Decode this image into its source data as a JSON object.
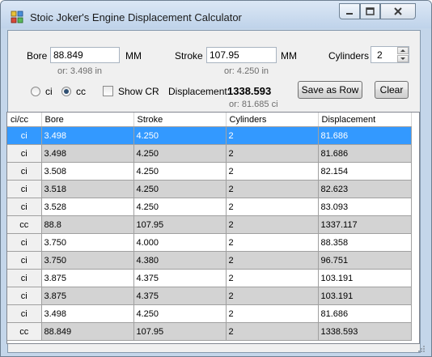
{
  "window": {
    "title": "Stoic Joker's Engine Displacement Calculator"
  },
  "inputs": {
    "bore_label": "Bore",
    "bore_value": "88.849",
    "bore_unit": "MM",
    "bore_in": "or: 3.498 in",
    "stroke_label": "Stroke",
    "stroke_value": "107.95",
    "stroke_unit": "MM",
    "stroke_in": "or: 4.250 in",
    "cylinders_label": "Cylinders",
    "cylinders_value": "2"
  },
  "mode": {
    "ci_label": "ci",
    "cc_label": "cc",
    "selected": "cc",
    "show_cr_label": "Show CR",
    "show_cr_checked": false
  },
  "result": {
    "label": "Displacement:",
    "value": "1338.593",
    "ci": "or: 81.685 ci"
  },
  "buttons": {
    "save": "Save as Row",
    "clear": "Clear"
  },
  "table": {
    "columns": [
      "ci/cc",
      "Bore",
      "Stroke",
      "Cylinders",
      "Displacement"
    ],
    "rows": [
      [
        "ci",
        "3.498",
        "4.250",
        "2",
        "81.686"
      ],
      [
        "ci",
        "3.498",
        "4.250",
        "2",
        "81.686"
      ],
      [
        "ci",
        "3.508",
        "4.250",
        "2",
        "82.154"
      ],
      [
        "ci",
        "3.518",
        "4.250",
        "2",
        "82.623"
      ],
      [
        "ci",
        "3.528",
        "4.250",
        "2",
        "83.093"
      ],
      [
        "cc",
        "88.8",
        "107.95",
        "2",
        "1337.117"
      ],
      [
        "ci",
        "3.750",
        "4.000",
        "2",
        "88.358"
      ],
      [
        "ci",
        "3.750",
        "4.380",
        "2",
        "96.751"
      ],
      [
        "ci",
        "3.875",
        "4.375",
        "2",
        "103.191"
      ],
      [
        "ci",
        "3.875",
        "4.375",
        "2",
        "103.191"
      ],
      [
        "ci",
        "3.498",
        "4.250",
        "2",
        "81.686"
      ],
      [
        "cc",
        "88.849",
        "107.95",
        "2",
        "1338.593"
      ]
    ],
    "selected_row": 0
  },
  "colors": {
    "selection": "#3399ff",
    "alt_row": "#d3d3d3",
    "window_frame": "#c4d6ea"
  }
}
